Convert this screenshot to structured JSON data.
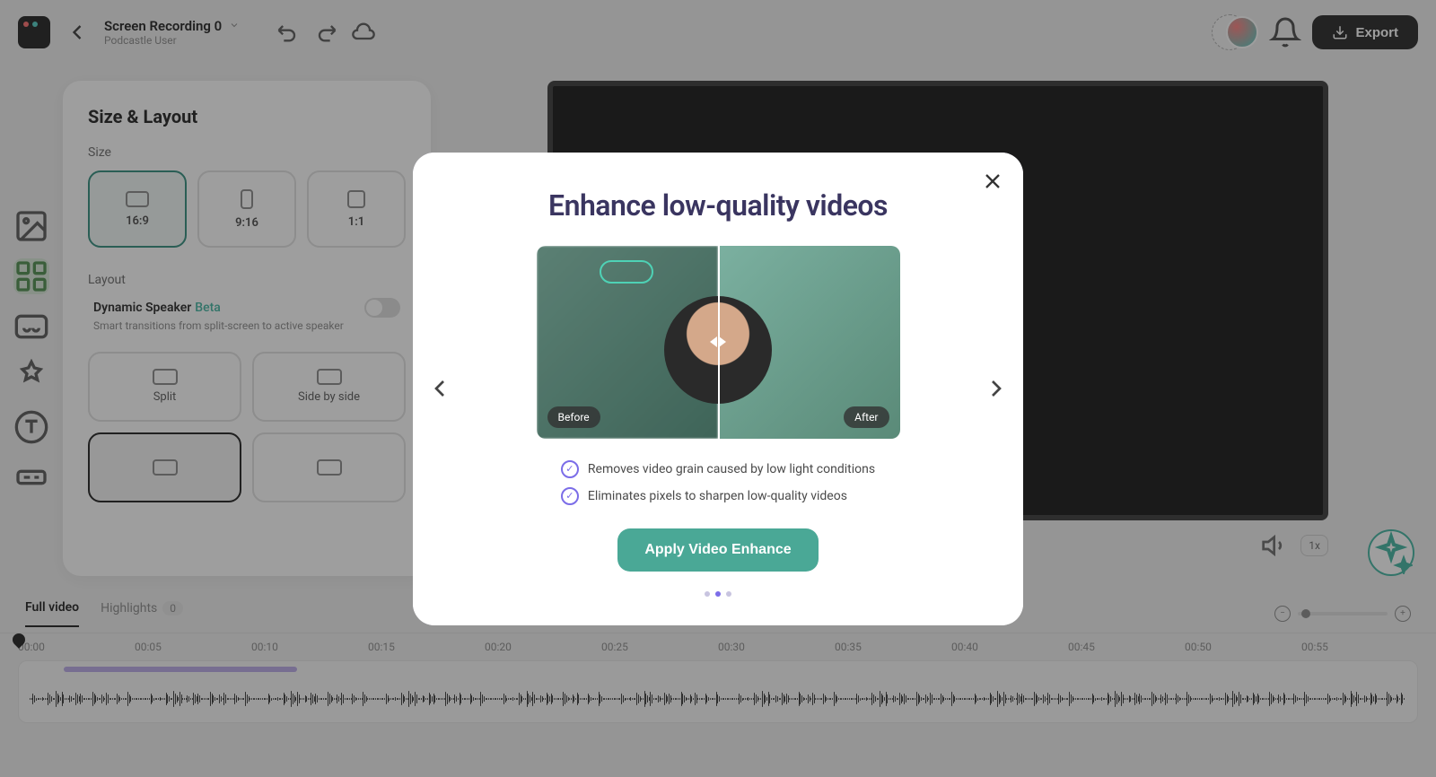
{
  "header": {
    "title": "Screen Recording 0",
    "subtitle": "Podcastle User",
    "export_label": "Export"
  },
  "panel": {
    "title": "Size & Layout",
    "size_label": "Size",
    "sizes": [
      "16:9",
      "9:16",
      "1:1"
    ],
    "layout_label": "Layout",
    "dynamic": {
      "title": "Dynamic Speaker",
      "beta": "Beta",
      "desc": "Smart transitions from split-screen to active speaker"
    },
    "layouts": [
      "Split",
      "Side by side"
    ]
  },
  "preview": {
    "speed": "1x"
  },
  "timeline": {
    "tabs": {
      "full": "Full video",
      "highlights": "Highlights",
      "count": "0"
    },
    "marks": [
      "00:00",
      "00:05",
      "00:10",
      "00:15",
      "00:20",
      "00:25",
      "00:30",
      "00:35",
      "00:40",
      "00:45",
      "00:50",
      "00:55"
    ]
  },
  "modal": {
    "title": "Enhance low-quality videos",
    "before": "Before",
    "after": "After",
    "features": [
      "Removes video grain caused by low light conditions",
      "Eliminates pixels to sharpen low-quality videos"
    ],
    "cta": "Apply Video Enhance"
  }
}
